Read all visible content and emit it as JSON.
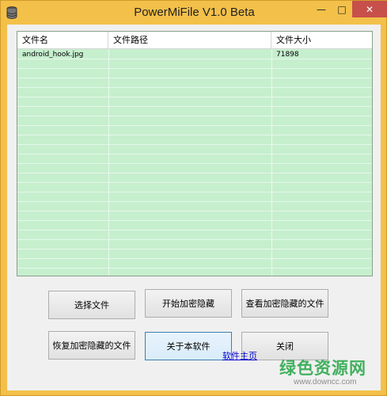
{
  "window": {
    "title": "PowerMiFile V1.0 Beta",
    "controls": {
      "minimize": "—",
      "maximize": "□",
      "close": "✕"
    }
  },
  "list": {
    "columns": [
      "文件名",
      "文件路径",
      "文件大小"
    ],
    "rows": [
      {
        "name": "android_hook.jpg",
        "path": "",
        "size": "71898"
      }
    ]
  },
  "buttons": {
    "select_file": "选择文件",
    "start_encrypt_hide": "开始加密隐藏",
    "view_encrypted": "查看加密隐藏的文件",
    "restore_encrypted": "恢复加密隐藏的文件",
    "about": "关于本软件",
    "close": "关闭"
  },
  "link": {
    "homepage": "软件主页"
  },
  "watermark": {
    "text": "绿色资源网",
    "url": "www.downcc.com"
  },
  "colors": {
    "frame": "#f3c049",
    "list_bg": "#c6efce",
    "close_button": "#c7504a",
    "link": "#0000cc",
    "watermark": "#2aa84a"
  },
  "icons": {
    "app": "database-icon"
  }
}
